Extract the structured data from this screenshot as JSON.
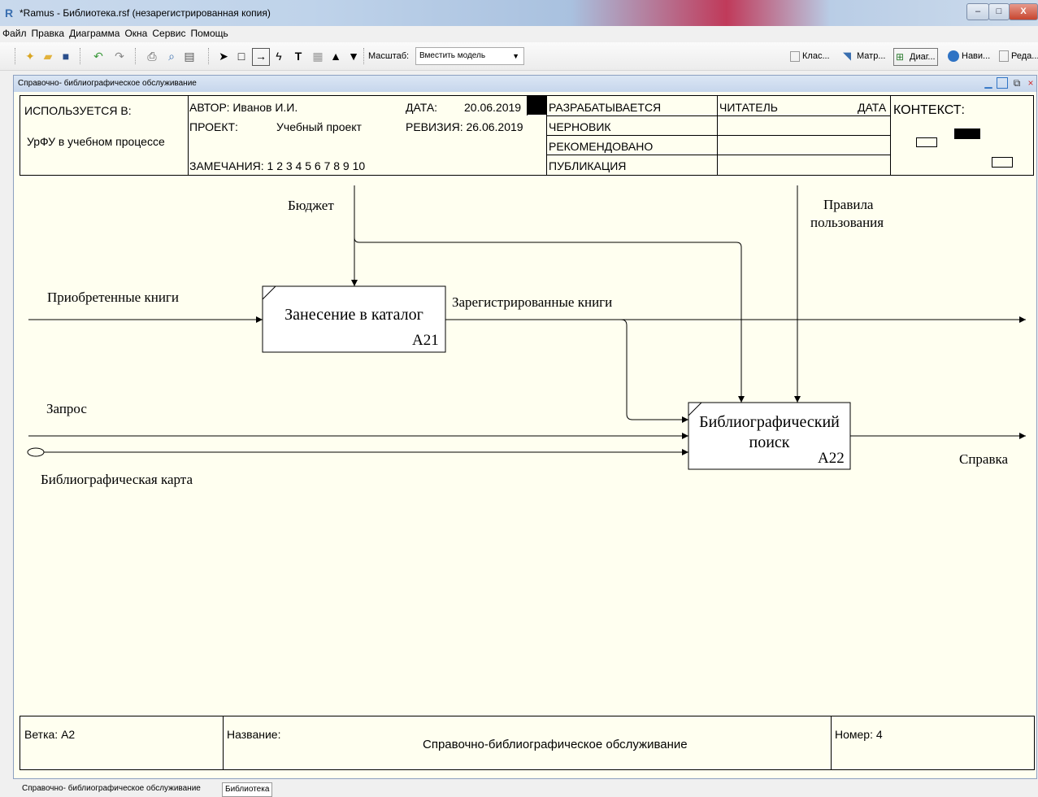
{
  "window": {
    "title": "*Ramus - Библиотека.rsf (незарегистрированная копия)",
    "min_glyph": "–",
    "max_glyph": "□",
    "close_glyph": "X"
  },
  "menu": [
    "Файл",
    "Правка",
    "Диаграмма",
    "Окна",
    "Сервис",
    "Помощь"
  ],
  "toolbar": {
    "zoom_label": "Масштаб:",
    "zoom_value": "Вместить модель",
    "right_buttons": [
      "Клас...",
      "Матр...",
      "Диаг...",
      "Нави...",
      "Реда..."
    ]
  },
  "doc": {
    "title": "Справочно- библиографическое обслуживание"
  },
  "header": {
    "used_in": "ИСПОЛЬЗУЕТСЯ В:",
    "used_in_value": "УрФУ в учебном процессе",
    "author": "АВТОР: Иванов И.И.",
    "project": "ПРОЕКТ:",
    "project_value": "Учебный проект",
    "notes": "ЗАМЕЧАНИЯ: 1 2 3 4 5 6 7 8 9 10",
    "date_label": "ДАТА:",
    "date_value": "20.06.2019",
    "revision": "РЕВИЗИЯ: 26.06.2019",
    "status": [
      "РАЗРАБАТЫВАЕТСЯ",
      "ЧЕРНОВИК",
      "РЕКОМЕНДОВАНО",
      "ПУБЛИКАЦИЯ"
    ],
    "reader": "ЧИТАТЕЛЬ",
    "reader_date": "ДАТА",
    "context": "КОНТЕКСТ:"
  },
  "diagram": {
    "boxes": [
      {
        "title": "Занесение в каталог",
        "number": "A21"
      },
      {
        "title": "Библиографический поиск",
        "title_line1": "Библиографический",
        "title_line2": "поиск",
        "number": "A22"
      }
    ],
    "arrow_labels": {
      "budget": "Бюджет",
      "rules_line1": "Правила",
      "rules_line2": "пользования",
      "acquired": "Приобретенные книги",
      "registered": "Зарегистрированные книги",
      "request": "Запрос",
      "card": "Библиографическая карта",
      "reference": "Справка"
    }
  },
  "footer": {
    "node": "Ветка: A2",
    "name_label": "Название:",
    "name_value": "Справочно-библиографическое обслуживание",
    "number": "Номер: 4"
  },
  "tabs": [
    "Справочно- библиографическое обслуживание",
    "Библиотека"
  ]
}
